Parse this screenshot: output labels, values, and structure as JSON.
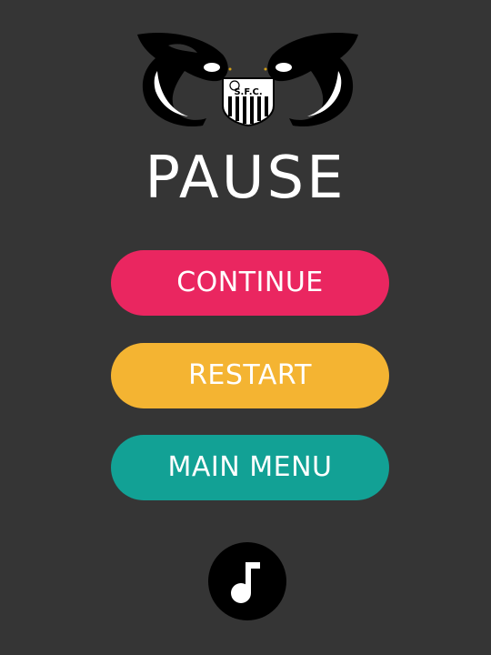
{
  "screen": {
    "title": "PAUSE",
    "background_color": "#353535"
  },
  "logo": {
    "icon": "orca-pair-with-club-crest-logo",
    "crest_text": "S.F.C."
  },
  "buttons": {
    "continue": {
      "label": "CONTINUE",
      "color": "#ea2660"
    },
    "restart": {
      "label": "RESTART",
      "color": "#f4b432"
    },
    "main_menu": {
      "label": "MAIN MENU",
      "color": "#12a195"
    }
  },
  "music_toggle": {
    "icon": "music-note-icon",
    "color": "#000000"
  }
}
